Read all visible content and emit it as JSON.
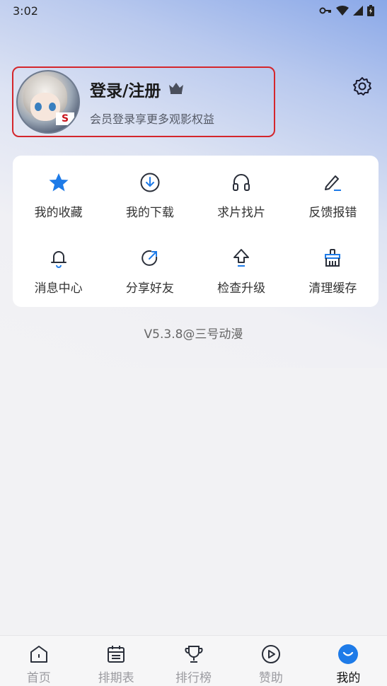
{
  "status_bar": {
    "time": "3:02",
    "icons": [
      "key-icon",
      "wifi-icon",
      "signal-icon",
      "battery-icon"
    ]
  },
  "profile": {
    "title": "登录/注册",
    "subtitle": "会员登录享更多观影权益",
    "badge_text": "S",
    "crown_icon": "crown-icon"
  },
  "settings_icon": "gear-icon",
  "menu": [
    {
      "label": "我的收藏",
      "icon": "star-icon"
    },
    {
      "label": "我的下载",
      "icon": "download-icon"
    },
    {
      "label": "求片找片",
      "icon": "headphones-icon"
    },
    {
      "label": "反馈报错",
      "icon": "edit-icon"
    },
    {
      "label": "消息中心",
      "icon": "bell-icon"
    },
    {
      "label": "分享好友",
      "icon": "share-icon"
    },
    {
      "label": "检查升级",
      "icon": "upgrade-icon"
    },
    {
      "label": "清理缓存",
      "icon": "broom-icon"
    }
  ],
  "version": "V5.3.8@三号动漫",
  "tabs": [
    {
      "label": "首页",
      "icon": "home-icon"
    },
    {
      "label": "排期表",
      "icon": "calendar-icon"
    },
    {
      "label": "排行榜",
      "icon": "trophy-icon"
    },
    {
      "label": "赞助",
      "icon": "play-circle-icon"
    },
    {
      "label": "我的",
      "icon": "profile-icon",
      "active": true
    }
  ],
  "colors": {
    "accent": "#1e7be8",
    "highlight_border": "#d4262c"
  }
}
